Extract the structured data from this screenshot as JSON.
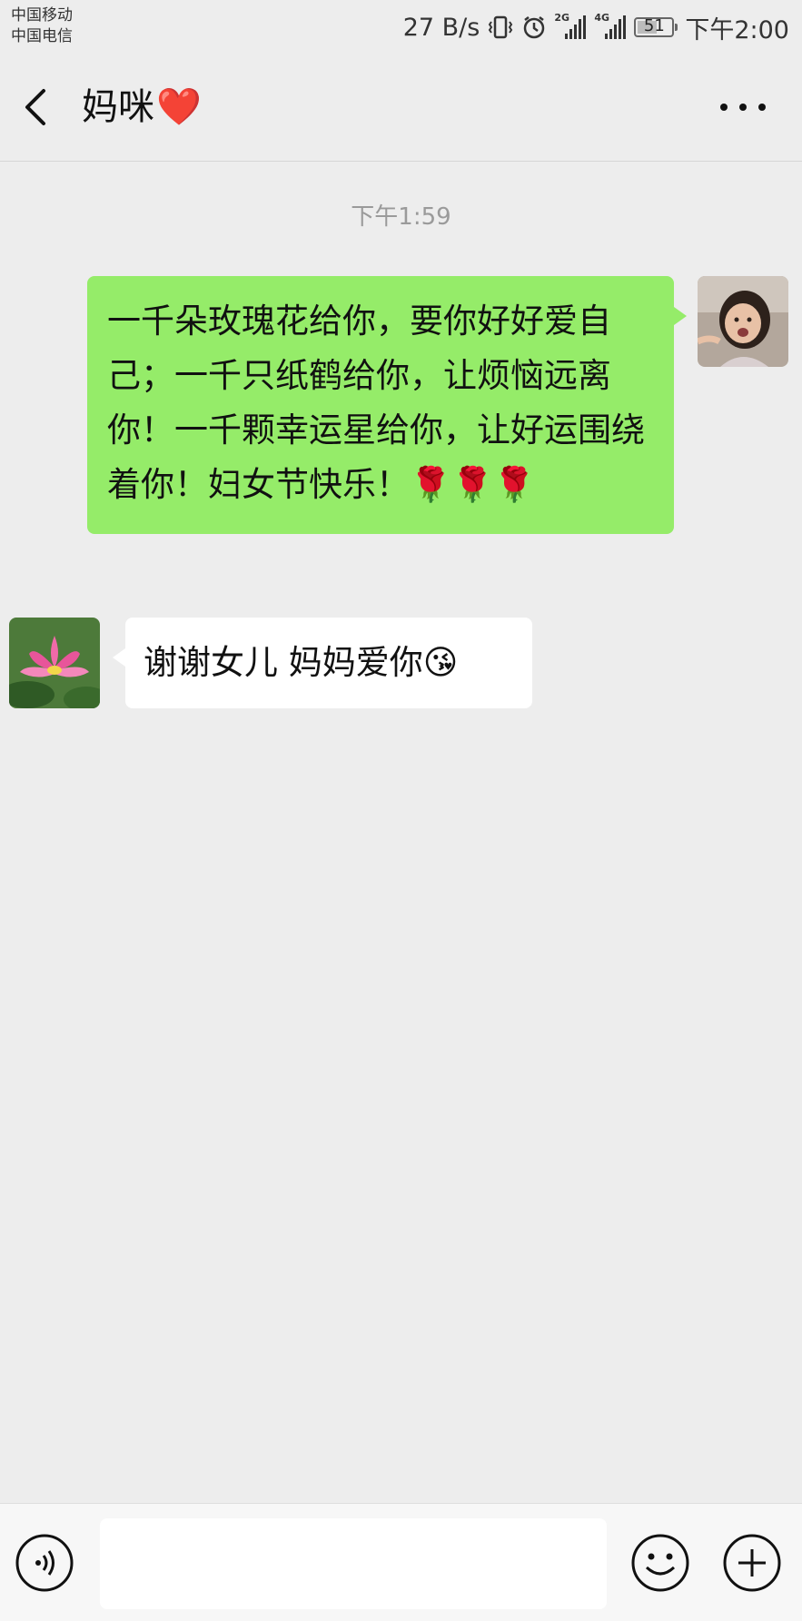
{
  "status_bar": {
    "carrier_1": "中国移动",
    "carrier_2": "中国电信",
    "net_speed": "27 B/s",
    "net_type_1": "2G",
    "net_type_2": "4G",
    "battery_level": "51",
    "time": "下午2:00"
  },
  "nav": {
    "contact_name": "妈咪",
    "title_emoji": "❤️"
  },
  "chat": {
    "timestamp": "下午1:59",
    "messages": [
      {
        "side": "right",
        "text": "一千朵玫瑰花给你，要你好好爱自己；一千只纸鹤给你，让烦恼远离你！一千颗幸运星给你，让好运围绕着你！妇女节快乐！🌹🌹🌹"
      },
      {
        "side": "left",
        "text": "谢谢女儿 妈妈爱你😘"
      }
    ]
  },
  "input": {
    "value": "",
    "placeholder": ""
  },
  "icons": {
    "back": "chevron-left-icon",
    "more": "more-dots-icon",
    "voice": "voice-icon",
    "emoji": "emoji-icon",
    "plus": "plus-icon"
  },
  "colors": {
    "background": "#ededed",
    "sent_bubble": "#95ec69",
    "received_bubble": "#ffffff"
  }
}
